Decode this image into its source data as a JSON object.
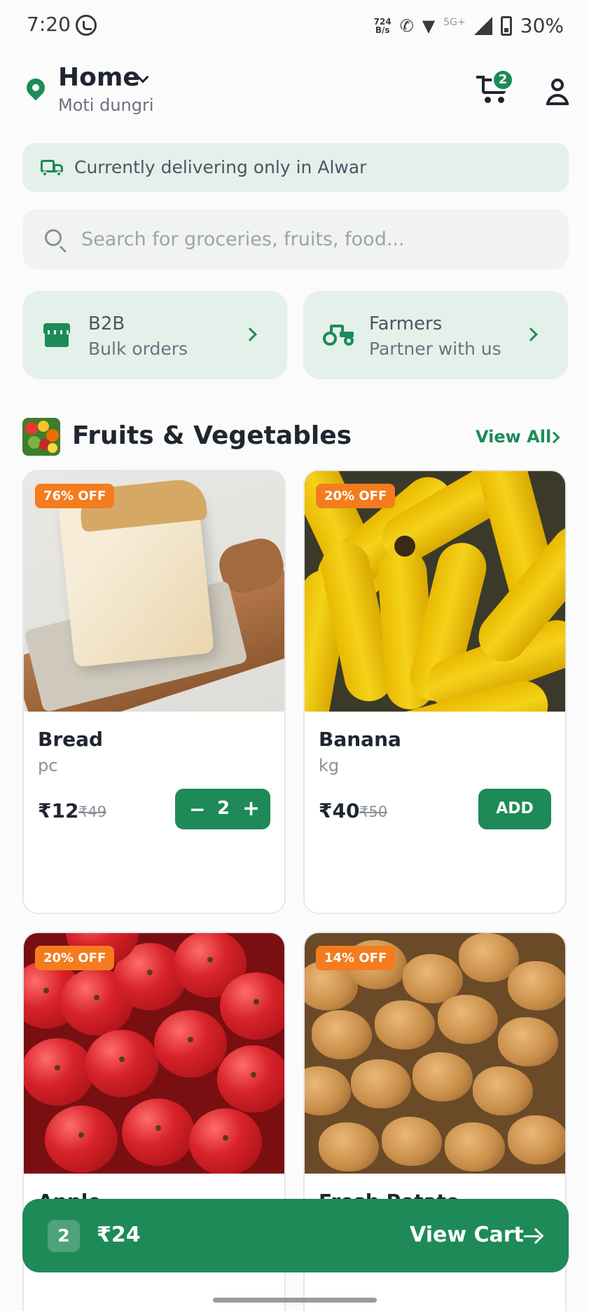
{
  "status_bar": {
    "time": "7:20",
    "net_speed_value": "724",
    "net_speed_unit": "B/s",
    "network_type": "5G+",
    "battery": "30%"
  },
  "header": {
    "location_title": "Home",
    "location_subtitle": "Moti dungri",
    "cart_count": "2"
  },
  "delivery_banner": {
    "text": "Currently delivering only in Alwar"
  },
  "search": {
    "placeholder": "Search for groceries, fruits, food..."
  },
  "quick_links": [
    {
      "title": "B2B",
      "subtitle": "Bulk orders",
      "icon": "store-icon"
    },
    {
      "title": "Farmers",
      "subtitle": "Partner with us",
      "icon": "tractor-icon"
    }
  ],
  "section": {
    "title": "Fruits & Vegetables",
    "view_all": "View All"
  },
  "products": [
    {
      "name": "Bread",
      "unit": "pc",
      "price": "₹12",
      "mrp": "₹49",
      "discount": "76% OFF",
      "in_cart": true,
      "qty": "2"
    },
    {
      "name": "Banana",
      "unit": "kg",
      "price": "₹40",
      "mrp": "₹50",
      "discount": "20% OFF",
      "in_cart": false,
      "add_label": "ADD"
    },
    {
      "name": "Apple",
      "discount": "20% OFF"
    },
    {
      "name": "Fresh Potato",
      "discount": "14% OFF"
    }
  ],
  "cart_bar": {
    "count": "2",
    "total": "₹24",
    "label": "View Cart"
  },
  "colors": {
    "brand_green": "#1e8a58",
    "light_green": "#e3f1ea",
    "discount_orange": "#f47c1f"
  }
}
